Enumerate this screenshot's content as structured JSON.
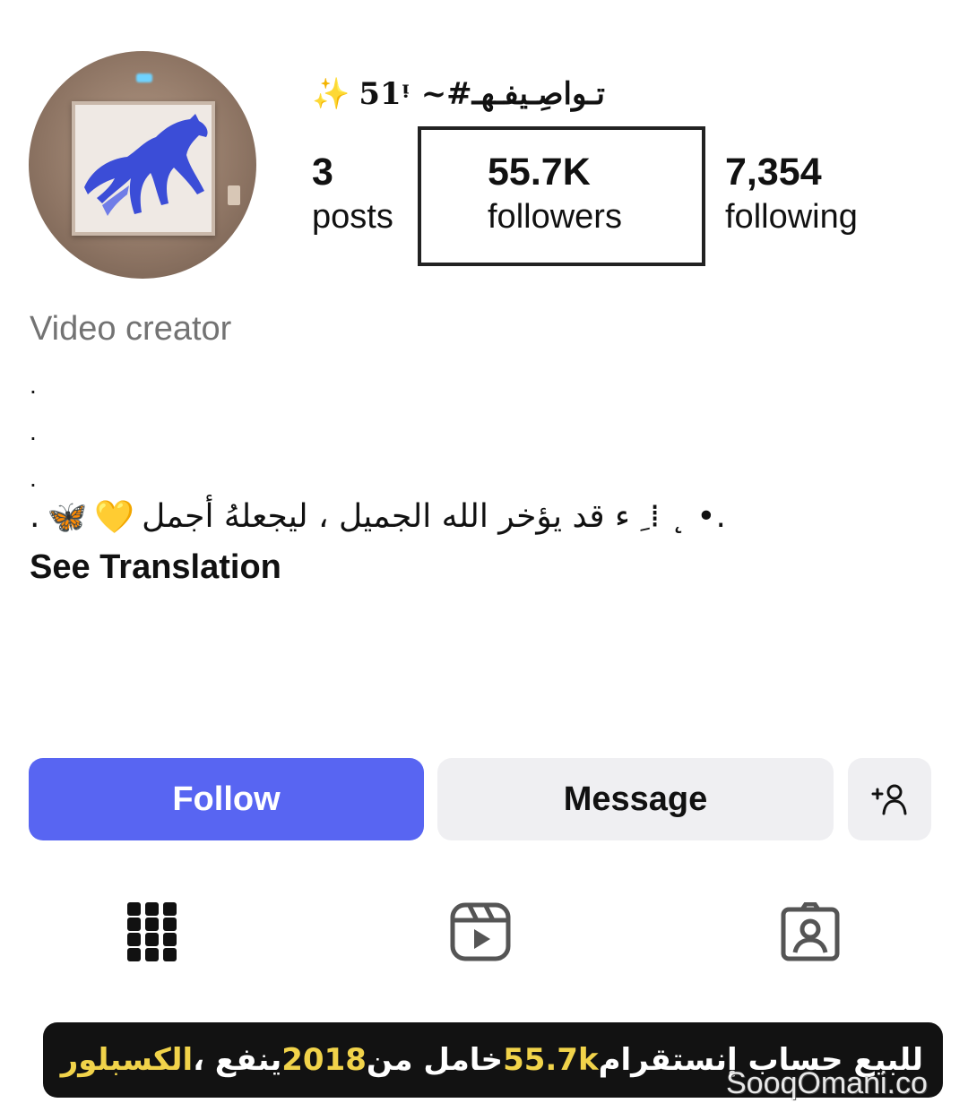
{
  "profile": {
    "username": "51ᵎ ~#تـواصِـيفـهـ",
    "username_sparkle": "✨",
    "stats": {
      "posts": {
        "value": "3",
        "label": "posts"
      },
      "followers": {
        "value": "55.7K",
        "label": "followers"
      },
      "following": {
        "value": "7,354",
        "label": "following"
      }
    },
    "category": "Video creator",
    "bio_dots": [
      ".",
      ".",
      "."
    ],
    "bio_text": ".• ˛ ⁞ ِ ء قد يؤخر الله الجميل ، ليجعلهُ أجمل",
    "bio_emojis": [
      "💛",
      "🦋"
    ],
    "bio_end": ".",
    "see_translation": "See Translation"
  },
  "actions": {
    "follow": "Follow",
    "message": "Message"
  },
  "tabs": [
    {
      "icon": "grid-icon"
    },
    {
      "icon": "reels-icon"
    },
    {
      "icon": "tagged-icon"
    }
  ],
  "banner": {
    "part1": "للبيع حساب إنستقرام ",
    "h1": "55.7k",
    "part2": " خامل من ",
    "h2": "2018",
    "part3": " ينفع ، ",
    "h3": "الكسبلور"
  },
  "watermark": "SooqOmani.co",
  "colors": {
    "follow_button": "#5865f2",
    "secondary_button": "#efeff2",
    "banner_highlight": "#f1d34a"
  }
}
